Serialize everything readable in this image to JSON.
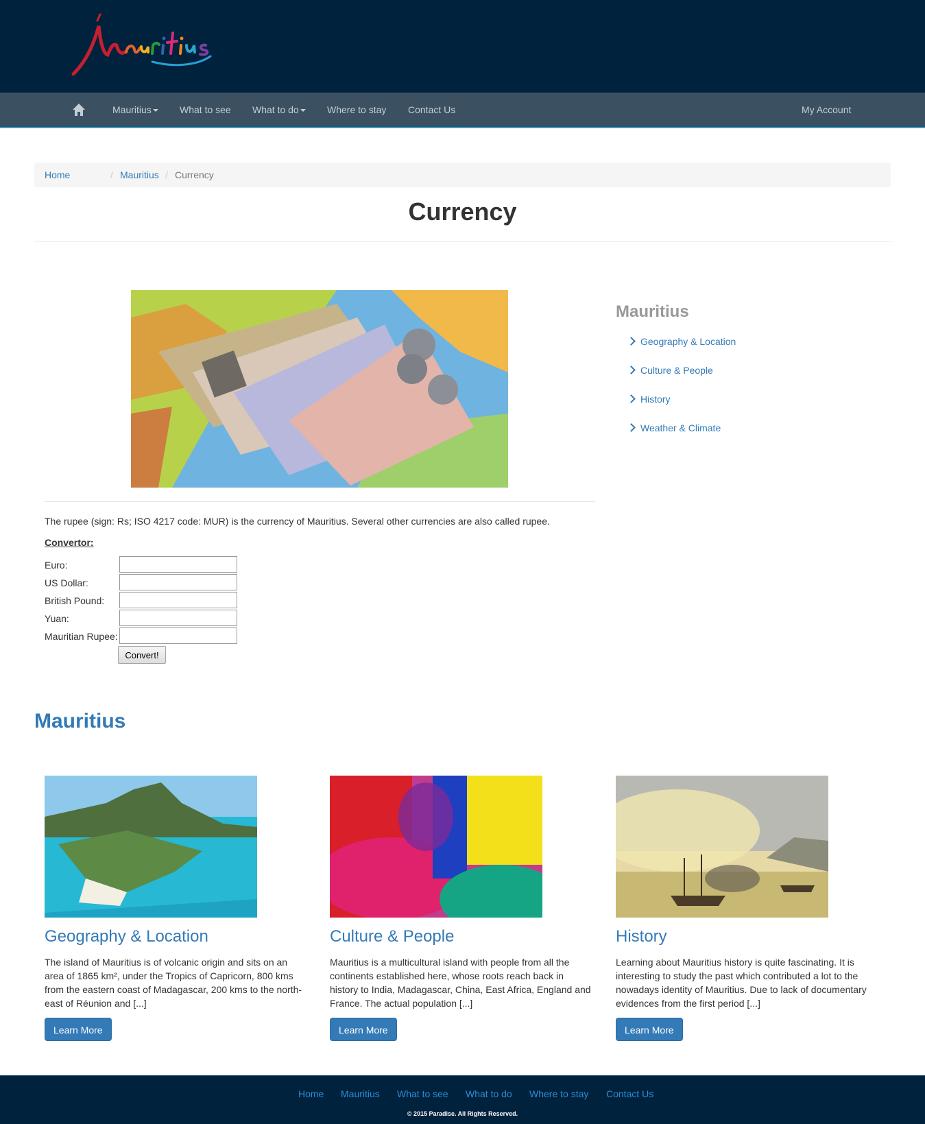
{
  "header": {
    "logo_text": "Mauritius"
  },
  "nav": {
    "home_icon": "home-icon",
    "items": [
      {
        "label": "Mauritius",
        "dropdown": true
      },
      {
        "label": "What to see",
        "dropdown": false
      },
      {
        "label": "What to do",
        "dropdown": true
      },
      {
        "label": "Where to stay",
        "dropdown": false
      },
      {
        "label": "Contact Us",
        "dropdown": false
      }
    ],
    "account": "My Account"
  },
  "breadcrumb": {
    "items": [
      "Home",
      "Mauritius",
      "Currency"
    ],
    "separator": "/"
  },
  "page_title": "Currency",
  "content": {
    "description": "The rupee (sign: Rs; ISO 4217 code: MUR) is the currency of Mauritius. Several other currencies are also called rupee.",
    "convertor_title": "Convertor:",
    "fields": [
      {
        "label": "Euro:",
        "value": ""
      },
      {
        "label": "US Dollar:",
        "value": ""
      },
      {
        "label": "British Pound:",
        "value": ""
      },
      {
        "label": "Yuan:",
        "value": ""
      },
      {
        "label": "Mauritian Rupee:",
        "value": ""
      }
    ],
    "convert_button": "Convert!"
  },
  "sidebar": {
    "title": "Mauritius",
    "links": [
      "Geography & Location",
      "Culture & People",
      "History",
      "Weather & Climate"
    ]
  },
  "section": {
    "title": "Mauritius",
    "cards": [
      {
        "title": "Geography & Location",
        "text": "The island of Mauritius is of volcanic origin and sits on an area of 1865 km², under the Tropics of Capricorn, 800 kms from the eastern coast of Madagascar, 200 kms to the north-east of Réunion and [...]",
        "button": "Learn More"
      },
      {
        "title": "Culture & People",
        "text": "Mauritius is a multicultural island with people from all the continents established here, whose roots reach back in history to India, Madagascar, China, East Africa, England and France. The actual population [...]",
        "button": "Learn More"
      },
      {
        "title": "History",
        "text": "Learning about Mauritius history is quite fascinating. It is interesting to study the past which contributed a lot to the nowadays identity of Mauritius. Due to lack of documentary evidences from the first period [...]",
        "button": "Learn More"
      }
    ]
  },
  "footer": {
    "links": [
      "Home",
      "Mauritius",
      "What to see",
      "What to do",
      "Where to stay",
      "Contact Us"
    ],
    "copyright": "© 2015 Paradise. All Rights Reserved."
  },
  "colors": {
    "header_bg": "#01223d",
    "nav_bg": "#3b5161",
    "link": "#337ab7",
    "accent_line": "#2a9fd6"
  }
}
